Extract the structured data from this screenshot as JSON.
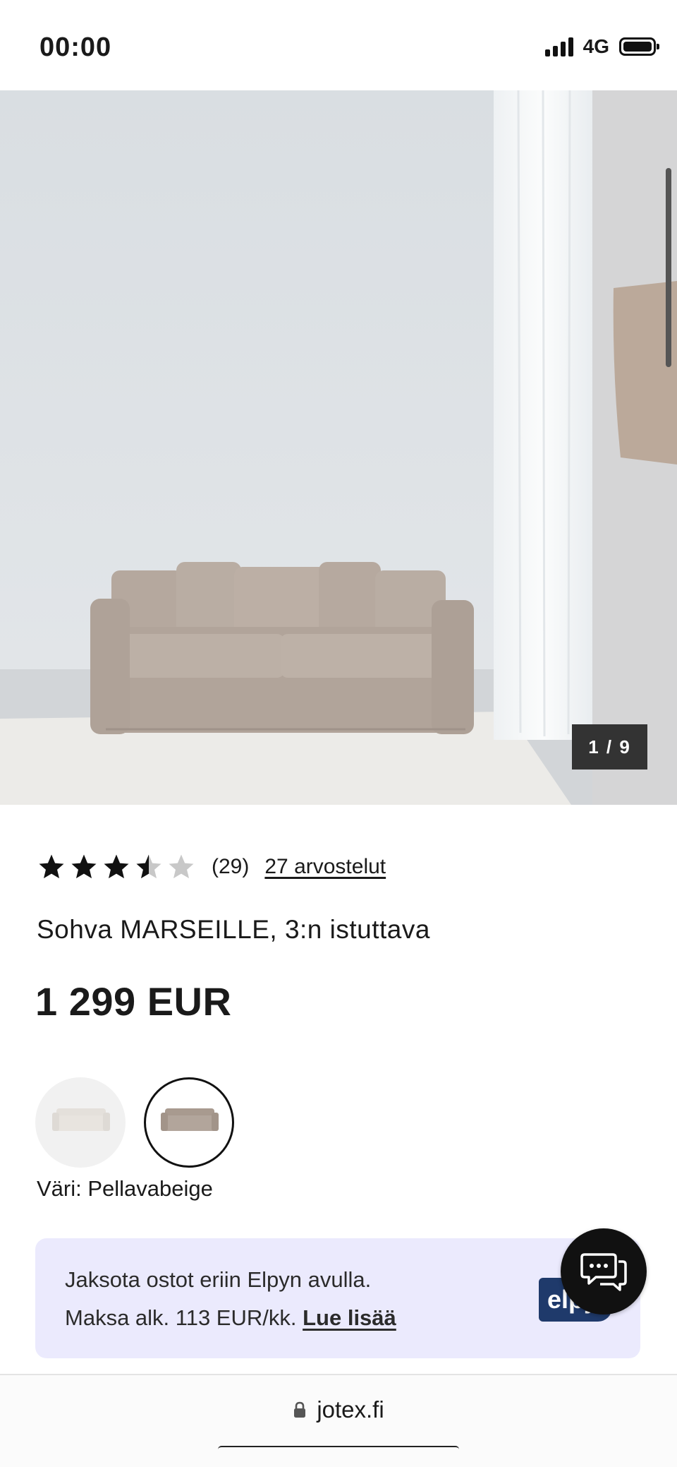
{
  "status_bar": {
    "time": "00:00",
    "network": "4G"
  },
  "gallery": {
    "counter": "1 / 9",
    "image_alt": "Sohva MARSEILLE pellavabeige olohuoneessa"
  },
  "product": {
    "rating_value": 3.5,
    "rating_max": 5,
    "rating_count": "(29)",
    "reviews_link": "27 arvostelut",
    "title": "Sohva MARSEILLE, 3:n istuttava",
    "price": "1 299 EUR",
    "color_label": "Väri: Pellavabeige",
    "swatches": [
      {
        "name": "white",
        "color": "#ede9e4",
        "selected": false
      },
      {
        "name": "pellavabeige",
        "color": "#b8aba1",
        "selected": true
      }
    ]
  },
  "payment_banner": {
    "line1": "Jaksota ostot eriin Elpyn avulla.",
    "line2_prefix": "Maksa alk. 113 EUR/kk.",
    "link": "Lue lisää",
    "logo_text": "elpy"
  },
  "browser": {
    "url": "jotex.fi"
  },
  "colors": {
    "accent": "#111111",
    "banner_bg": "#ebeafd",
    "counter_bg": "#333333",
    "sofa": "#b8aba1"
  }
}
